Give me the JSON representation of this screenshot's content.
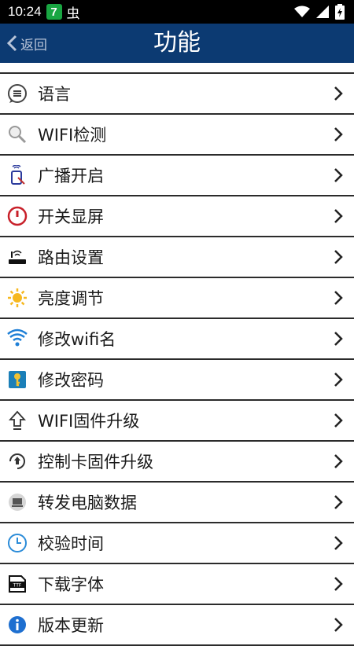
{
  "status_bar": {
    "time": "10:24",
    "badge": "7",
    "bug_glyph": "虫"
  },
  "header": {
    "back_label": "返回",
    "title": "功能"
  },
  "menu": {
    "items": [
      {
        "label": "语言",
        "icon": "language-icon"
      },
      {
        "label": "WIFI检测",
        "icon": "magnifier-icon"
      },
      {
        "label": "广播开启",
        "icon": "broadcast-icon"
      },
      {
        "label": "开关显屏",
        "icon": "power-icon"
      },
      {
        "label": "路由设置",
        "icon": "router-icon"
      },
      {
        "label": "亮度调节",
        "icon": "sun-icon"
      },
      {
        "label": "修改wifi名",
        "icon": "wifi-icon"
      },
      {
        "label": "修改密码",
        "icon": "key-icon"
      },
      {
        "label": "WIFI固件升级",
        "icon": "upload-arrow-icon"
      },
      {
        "label": "控制卡固件升级",
        "icon": "refresh-upload-icon"
      },
      {
        "label": "转发电脑数据",
        "icon": "forward-data-icon"
      },
      {
        "label": "校验时间",
        "icon": "clock-icon"
      },
      {
        "label": "下载字体",
        "icon": "font-file-icon"
      },
      {
        "label": "版本更新",
        "icon": "info-icon"
      }
    ]
  },
  "colors": {
    "header_bg": "#0c3a72",
    "badge": "#19a642",
    "divider": "#2b2b2b"
  }
}
